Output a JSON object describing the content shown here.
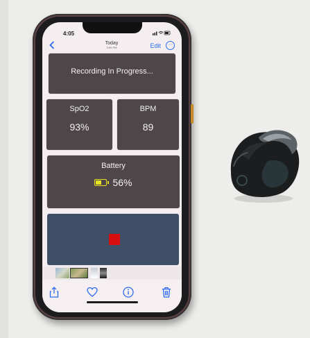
{
  "status_bar": {
    "time": "4:05",
    "icons": "..ll ≈ ▭"
  },
  "nav": {
    "back_icon": "chevron-left-icon",
    "title": "Today",
    "subtitle": "3:59 PM",
    "edit_label": "Edit",
    "more_icon": "ellipsis-circle-icon"
  },
  "recording": {
    "label": "Recording In Progress..."
  },
  "metrics": {
    "spo2": {
      "label": "SpO2",
      "value": "93%"
    },
    "bpm": {
      "label": "BPM",
      "value": "89"
    }
  },
  "battery": {
    "label": "Battery",
    "value": "56%",
    "level": 0.56,
    "icon_color": "#e6e21b"
  },
  "stop_button": {
    "icon": "stop-square-icon",
    "color": "#d80e0e",
    "background": "#3e4f67"
  },
  "toolbar": {
    "share_icon": "share-icon",
    "favorite_icon": "heart-icon",
    "info_icon": "info-icon",
    "delete_icon": "trash-icon"
  },
  "accent_color": "#2a6cf0",
  "card_color": "#4e4648"
}
